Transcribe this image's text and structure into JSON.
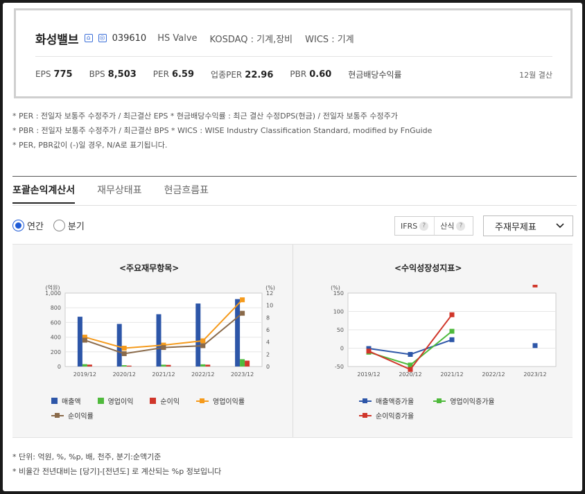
{
  "company": {
    "name": "화성밸브",
    "code": "039610",
    "eng_name": "HS Valve",
    "market": "KOSDAQ : 기계,장비",
    "wics": "WICS : 기계",
    "icons": [
      "home-icon",
      "ir-icon"
    ]
  },
  "metrics": {
    "eps_label": "EPS",
    "eps": "775",
    "bps_label": "BPS",
    "bps": "8,503",
    "per_label": "PER",
    "per": "6.59",
    "sector_per_label": "업종PER",
    "sector_per": "22.96",
    "pbr_label": "PBR",
    "pbr": "0.60",
    "dividend_label": "현금배당수익률",
    "settlement": "12월 결산"
  },
  "notes": [
    "* PER : 전일자 보통주 수정주가 / 최근결산 EPS * 현금배당수익률 : 최근 결산 수정DPS(현금) / 전일자 보통주 수정주가",
    "* PBR : 전일자 보통주 수정주가 / 최근결산 BPS * WICS : WISE Industry Classification Standard, modified by FnGuide",
    "* PER, PBR값이 (-)일 경우, N/A로 표기됩니다."
  ],
  "tabs": [
    "포괄손익계산서",
    "재무상태표",
    "현금흐름표"
  ],
  "period": {
    "annual": "연간",
    "quarter": "분기",
    "selected": "annual"
  },
  "standards": {
    "ifrs": "IFRS",
    "calc": "산식",
    "help": "?"
  },
  "statement_select": "주재무제표",
  "chart_data": [
    {
      "type": "bar",
      "title": "<주요재무항목>",
      "xlabel": "",
      "ylabel": "(억원)",
      "y2label": "(%)",
      "categories": [
        "2019/12",
        "2020/12",
        "2021/12",
        "2022/12",
        "2023/12"
      ],
      "ylim": [
        0,
        1000
      ],
      "y2lim": [
        0,
        12
      ],
      "yticks": [
        "0",
        "200",
        "400",
        "600",
        "800",
        "1,000"
      ],
      "y2ticks": [
        "0",
        "2",
        "4",
        "6",
        "8",
        "10",
        "12"
      ],
      "series": [
        {
          "name": "매출액",
          "kind": "bar",
          "axis": "left",
          "color": "#2d56a8",
          "values": [
            678,
            580,
            712,
            858,
            918
          ]
        },
        {
          "name": "영업이익",
          "kind": "bar",
          "axis": "left",
          "color": "#4fba3c",
          "values": [
            32,
            18,
            25,
            30,
            100
          ]
        },
        {
          "name": "순이익",
          "kind": "bar",
          "axis": "left",
          "color": "#d0362a",
          "values": [
            26,
            12,
            22,
            25,
            80
          ]
        },
        {
          "name": "영업이익률",
          "kind": "line",
          "axis": "right",
          "color": "#f59a1b",
          "values": [
            4.8,
            3.0,
            3.5,
            4.2,
            10.9
          ]
        },
        {
          "name": "순이익률",
          "kind": "line",
          "axis": "right",
          "color": "#8a6a4a",
          "values": [
            4.3,
            2.1,
            3.1,
            3.4,
            8.7
          ]
        }
      ],
      "legend": "bottom",
      "grid": true
    },
    {
      "type": "line",
      "title": "<수익성장성지표>",
      "xlabel": "",
      "ylabel": "(%)",
      "categories": [
        "2019/12",
        "2020/12",
        "2021/12",
        "2022/12",
        "2023/12"
      ],
      "ylim": [
        -50,
        150
      ],
      "yticks": [
        "-50",
        "0",
        "50",
        "100",
        "150"
      ],
      "series": [
        {
          "name": "매출액증가율",
          "color": "#2d56a8",
          "values": [
            -1,
            -17,
            23,
            null,
            7
          ]
        },
        {
          "name": "영업이익증가율",
          "color": "#4fba3c",
          "values": [
            -11,
            -46,
            46,
            null,
            null
          ]
        },
        {
          "name": "순이익증가율",
          "color": "#d0362a",
          "values": [
            -8,
            -58,
            91,
            null,
            172
          ]
        }
      ],
      "legend": "bottom",
      "grid": true
    }
  ],
  "footnotes": [
    "* 단위: 억원, %, %p, 배, 천주, 분기:순액기준",
    "* 비율간 전년대비는 [당기]-[전년도] 로 계산되는 %p 정보입니다"
  ]
}
